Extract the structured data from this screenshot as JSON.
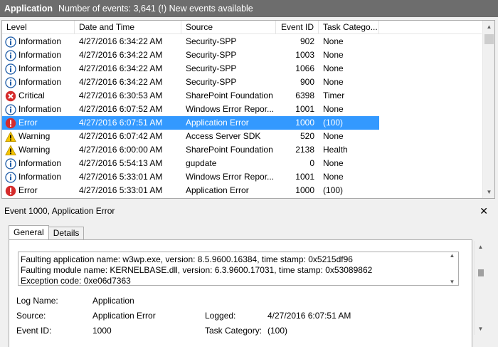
{
  "titlebar": {
    "log_name": "Application",
    "event_count": "Number of events: 3,641 (!) New events available"
  },
  "columns": {
    "level": "Level",
    "date": "Date and Time",
    "source": "Source",
    "event_id": "Event ID",
    "category": "Task Catego..."
  },
  "events": [
    {
      "level": "Information",
      "icon": "information-icon",
      "date": "4/27/2016 6:34:22 AM",
      "source": "Security-SPP",
      "event_id": "902",
      "category": "None"
    },
    {
      "level": "Information",
      "icon": "information-icon",
      "date": "4/27/2016 6:34:22 AM",
      "source": "Security-SPP",
      "event_id": "1003",
      "category": "None"
    },
    {
      "level": "Information",
      "icon": "information-icon",
      "date": "4/27/2016 6:34:22 AM",
      "source": "Security-SPP",
      "event_id": "1066",
      "category": "None"
    },
    {
      "level": "Information",
      "icon": "information-icon",
      "date": "4/27/2016 6:34:22 AM",
      "source": "Security-SPP",
      "event_id": "900",
      "category": "None"
    },
    {
      "level": "Critical",
      "icon": "critical-icon",
      "date": "4/27/2016 6:30:53 AM",
      "source": "SharePoint Foundation",
      "event_id": "6398",
      "category": "Timer"
    },
    {
      "level": "Information",
      "icon": "information-icon",
      "date": "4/27/2016 6:07:52 AM",
      "source": "Windows Error Repor...",
      "event_id": "1001",
      "category": "None"
    },
    {
      "level": "Error",
      "icon": "error-icon",
      "date": "4/27/2016 6:07:51 AM",
      "source": "Application Error",
      "event_id": "1000",
      "category": "(100)",
      "selected": true
    },
    {
      "level": "Warning",
      "icon": "warning-icon",
      "date": "4/27/2016 6:07:42 AM",
      "source": "Access Server SDK",
      "event_id": "520",
      "category": "None"
    },
    {
      "level": "Warning",
      "icon": "warning-icon",
      "date": "4/27/2016 6:00:00 AM",
      "source": "SharePoint Foundation",
      "event_id": "2138",
      "category": "Health"
    },
    {
      "level": "Information",
      "icon": "information-icon",
      "date": "4/27/2016 5:54:13 AM",
      "source": "gupdate",
      "event_id": "0",
      "category": "None"
    },
    {
      "level": "Information",
      "icon": "information-icon",
      "date": "4/27/2016 5:33:01 AM",
      "source": "Windows Error Repor...",
      "event_id": "1001",
      "category": "None"
    },
    {
      "level": "Error",
      "icon": "error-icon",
      "date": "4/27/2016 5:33:01 AM",
      "source": "Application Error",
      "event_id": "1000",
      "category": "(100)"
    }
  ],
  "detail": {
    "title": "Event 1000, Application Error",
    "tabs": [
      "General",
      "Details"
    ],
    "description": [
      "Faulting application name: w3wp.exe, version: 8.5.9600.16384, time stamp: 0x5215df96",
      "Faulting module name: KERNELBASE.dll, version: 6.3.9600.17031, time stamp: 0x53089862",
      "Exception code: 0xe06d7363"
    ],
    "labels": {
      "log_name": "Log Name:",
      "source": "Source:",
      "event_id": "Event ID:",
      "logged": "Logged:",
      "task_category": "Task Category:"
    },
    "values": {
      "log_name": "Application",
      "source": "Application Error",
      "event_id": "1000",
      "logged": "4/27/2016 6:07:51 AM",
      "task_category": "(100)"
    }
  },
  "colors": {
    "selection": "#3399ff",
    "titlebar": "#6d6d6d"
  }
}
